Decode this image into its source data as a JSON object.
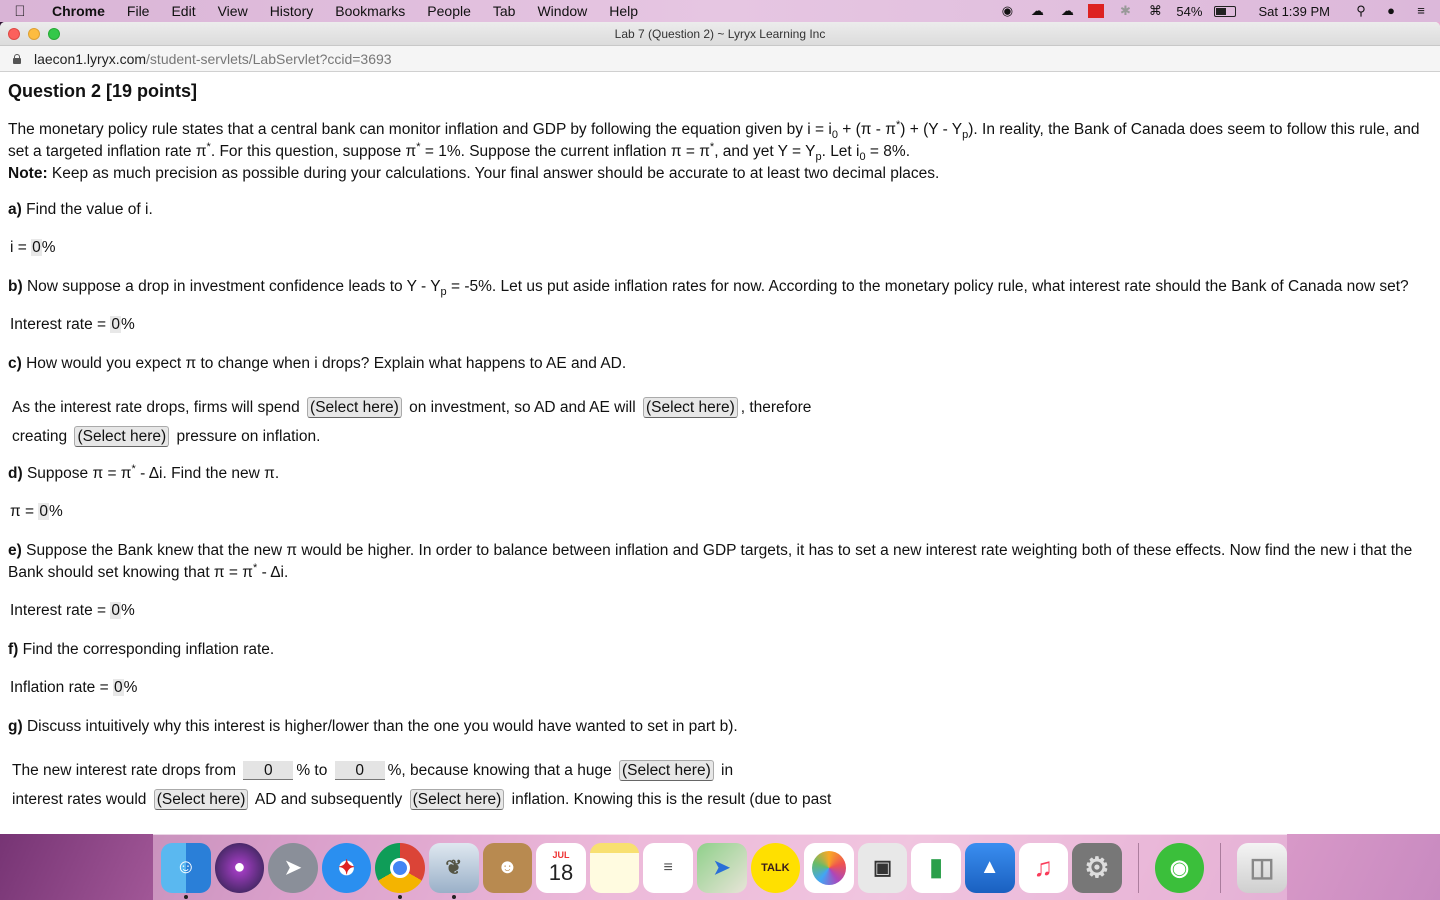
{
  "menubar": {
    "app_name": "Chrome",
    "items": [
      "File",
      "Edit",
      "View",
      "History",
      "Bookmarks",
      "People",
      "Tab",
      "Window",
      "Help"
    ],
    "battery": "54%",
    "clock": "Sat 1:39 PM"
  },
  "window": {
    "title": "Lab 7 (Question 2) ~ Lyryx Learning Inc",
    "url_host": "laecon1.lyryx.com",
    "url_path": "/student-servlets/LabServlet?ccid=3693"
  },
  "question": {
    "heading": "Question 2 [19 points]",
    "intro_1": "The monetary policy rule states that a central bank can monitor inflation and GDP by following the equation given by i = i",
    "intro_2": " + (π - π",
    "intro_3": ") + (Y - Y",
    "intro_4": "). In reality, the Bank of Canada does seem to follow this rule, and set a targeted inflation rate π",
    "intro_5": ". For this question, suppose π",
    "intro_6": " = 1%. Suppose the current inflation π = π",
    "intro_7": ", and yet Y = Y",
    "intro_8": ". Let i",
    "intro_9": " = 8%.",
    "sub_0": "0",
    "sub_p": "p",
    "sup_star": "*",
    "note_label": "Note:",
    "note_text": " Keep as much precision as possible during your calculations. Your final answer should be accurate to at least two decimal places."
  },
  "parts": {
    "a": {
      "label": "a)",
      "text": " Find the value of i.",
      "answer_prefix": "i = ",
      "value": "0",
      "unit": "%"
    },
    "b": {
      "label": "b)",
      "text_1": " Now suppose a drop in investment confidence leads to Y - Y",
      "text_2": " = -5%. Let us put aside inflation rates for now. According to the monetary policy rule, what interest rate should the Bank of Canada now set?",
      "answer_prefix": "Interest rate = ",
      "value": "0",
      "unit": "%"
    },
    "c": {
      "label": "c)",
      "text": " How would you expect π to change when i drops? Explain what happens to AE and AD.",
      "s1": "As the interest rate drops, firms will spend",
      "s2": "on investment, so AD and AE will",
      "s3": ", therefore",
      "s4": "creating",
      "s5": "pressure on inflation.",
      "select": "(Select here)"
    },
    "d": {
      "label": "d)",
      "text_1": " Suppose π = π",
      "text_2": " - Δi. Find the new π.",
      "answer_prefix": "π = ",
      "value": "0",
      "unit": "%"
    },
    "e": {
      "label": "e)",
      "text_1": " Suppose the Bank knew that the new π would be higher. In order to balance between inflation and GDP targets, it has to set a new interest rate weighting both of these effects. Now find the new i that the Bank should set knowing that π = π",
      "text_2": " - Δi.",
      "answer_prefix": "Interest rate = ",
      "value": "0",
      "unit": "%"
    },
    "f": {
      "label": "f)",
      "text": " Find the corresponding inflation rate.",
      "answer_prefix": "Inflation rate = ",
      "value": "0",
      "unit": "%"
    },
    "g": {
      "label": "g)",
      "text": " Discuss intuitively why this interest is higher/lower than the one you would have wanted to set in part b).",
      "s1": "The new interest rate drops from",
      "input1": "0",
      "s2": "% to",
      "input2": "0",
      "s3": "%, because knowing that a huge",
      "select": "(Select here)",
      "s4": "in",
      "s5": "interest rates would",
      "s6": "AD and subsequently",
      "s7": "inflation. Knowing this is the result (due to past"
    }
  },
  "dock": {
    "calendar_month": "JUL",
    "calendar_day": "18",
    "talk_label": "TALK"
  }
}
